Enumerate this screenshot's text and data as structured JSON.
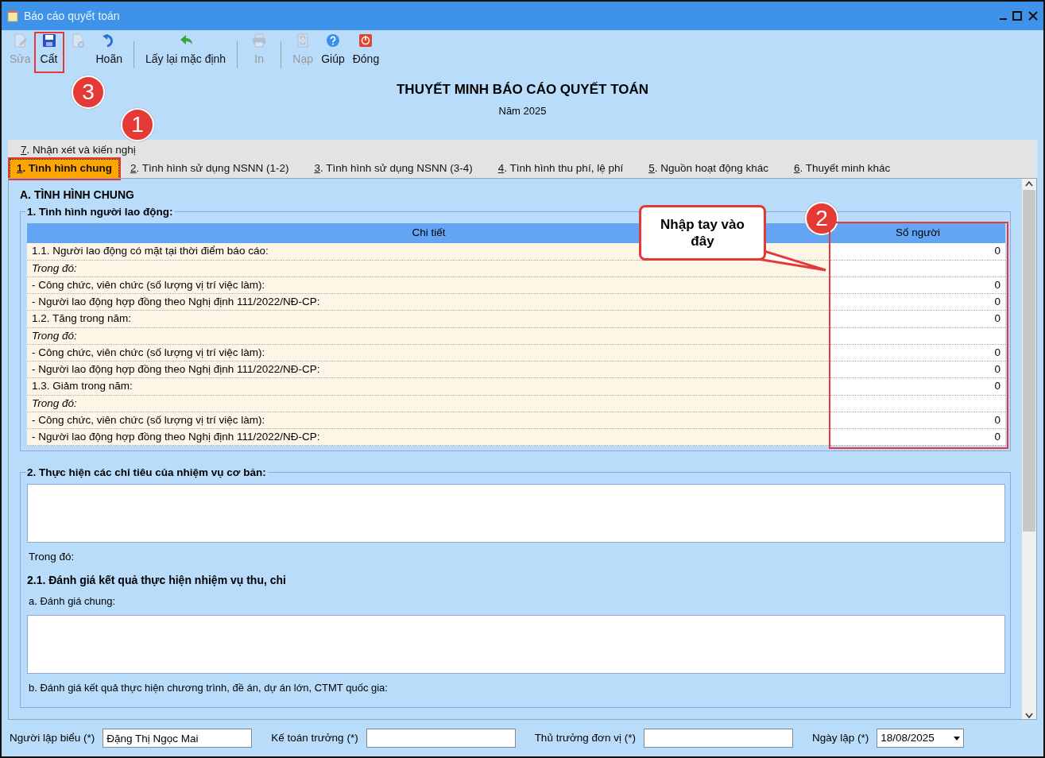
{
  "window": {
    "title": "Báo cáo quyết toán"
  },
  "toolbar": {
    "groups": [
      {
        "buttons": [
          {
            "kind": "edit",
            "label": "Sửa",
            "disabled": true,
            "highlighted": false
          },
          {
            "kind": "save",
            "label": "Cất",
            "disabled": false,
            "highlighted": true
          },
          {
            "kind": "delete",
            "disabled": true,
            "highlighted": false
          },
          {
            "kind": "undo",
            "label": "Hoãn",
            "disabled": false,
            "highlighted": false
          }
        ]
      },
      {
        "buttons": [
          {
            "kind": "reset",
            "label": "Lấy lại mặc định",
            "disabled": false,
            "highlighted": false
          }
        ]
      },
      {
        "buttons": [
          {
            "kind": "print",
            "label": "In",
            "disabled": true,
            "highlighted": false
          }
        ]
      },
      {
        "buttons": [
          {
            "kind": "load",
            "label": "Nạp",
            "disabled": true,
            "highlighted": false
          },
          {
            "kind": "help",
            "label": "Giúp",
            "disabled": false,
            "highlighted": false
          },
          {
            "kind": "close",
            "label": "Đóng",
            "disabled": false,
            "highlighted": false
          }
        ]
      }
    ]
  },
  "report": {
    "title": "THUYẾT MINH BÁO CÁO QUYẾT TOÁN",
    "subtitle": "Năm 2025"
  },
  "tab_rows": [
    [
      {
        "label": "7. Nhận xét và kiến nghị",
        "selected": false,
        "highlighted": false
      }
    ],
    [
      {
        "label": "1. Tình hình chung",
        "selected": true,
        "highlighted": true
      },
      {
        "label": "2. Tình hình sử dụng NSNN (1-2)",
        "selected": false,
        "highlighted": false
      },
      {
        "label": "3. Tình hình sử dụng NSNN (3-4)",
        "selected": false,
        "highlighted": false
      },
      {
        "label": "4. Tình hình thu phí, lệ phí",
        "selected": false,
        "highlighted": false
      },
      {
        "label": "5. Nguồn hoạt động khác",
        "selected": false,
        "highlighted": false
      },
      {
        "label": "6. Thuyết minh khác",
        "selected": false,
        "highlighted": false
      }
    ]
  ],
  "section_title": "A. TÌNH HÌNH CHUNG",
  "group1": {
    "title": "1. Tình hình người lao động:",
    "table": {
      "columns": [
        {
          "label": "Chi tiết",
          "highlighted": false
        },
        {
          "label": "Số người",
          "highlighted": true
        }
      ],
      "rows": [
        {
          "kind": "item",
          "label": "1.1. Người lao động có mặt tại thời điểm báo cáo:",
          "value": "0"
        },
        {
          "kind": "note",
          "label": "Trong đó:"
        },
        {
          "kind": "item",
          "label": "- Công chức, viên chức (số lượng vị trí việc làm):",
          "value": "0"
        },
        {
          "kind": "item",
          "label": "- Người lao động hợp đồng theo Nghị định 111/2022/NĐ-CP:",
          "value": "0"
        },
        {
          "kind": "item",
          "label": "1.2. Tăng trong năm:",
          "value": "0"
        },
        {
          "kind": "note",
          "label": "Trong đó:"
        },
        {
          "kind": "item",
          "label": "- Công chức, viên chức (số lượng vị trí việc làm):",
          "value": "0"
        },
        {
          "kind": "item",
          "label": "- Người lao động hợp đồng theo Nghị định 111/2022/NĐ-CP:",
          "value": "0"
        },
        {
          "kind": "item",
          "label": "1.3. Giảm trong năm:",
          "value": "0"
        },
        {
          "kind": "note",
          "label": "Trong đó:"
        },
        {
          "kind": "item",
          "label": "- Công chức, viên chức (số lượng vị trí việc làm):",
          "value": "0"
        },
        {
          "kind": "item",
          "label": "- Người lao động hợp đồng theo Nghị định 111/2022/NĐ-CP:",
          "value": "0"
        }
      ]
    }
  },
  "group2": {
    "title": "2. Thực hiện các chỉ tiêu của nhiệm vụ cơ bản:",
    "note": "Trong đó:",
    "subheading": "2.1. Đánh giá kết quả thực hiện nhiệm vụ thu, chi",
    "label_a": "a. Đánh giá chung:",
    "label_b": "b. Đánh giá kết quả thực hiện chương trình, đề án, dự án lớn, CTMT quốc gia:"
  },
  "footer": {
    "fields": [
      {
        "kind": "text",
        "label": "Người lập biểu (*)",
        "value": "Đặng Thị Ngọc Mai"
      },
      {
        "kind": "text",
        "label": "Kế toán trưởng (*)"
      },
      {
        "kind": "text",
        "label": "Thủ trưởng đơn vị (*)"
      },
      {
        "kind": "date",
        "label": "Ngày lập (*)",
        "value": "18/08/2025"
      }
    ]
  },
  "annotations": [
    {
      "kind": "badge",
      "text": "1"
    },
    {
      "kind": "badge",
      "text": "2"
    },
    {
      "kind": "badge",
      "text": "3"
    },
    {
      "kind": "callout",
      "text": "Nhập tay vào đây"
    }
  ]
}
